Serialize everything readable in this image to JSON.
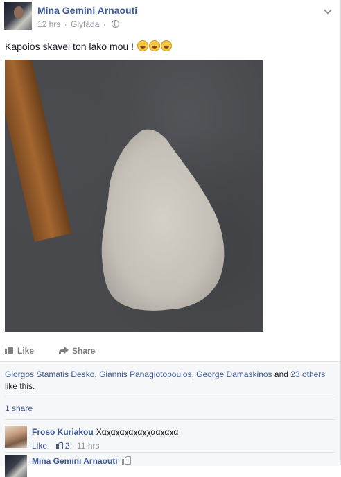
{
  "post": {
    "author": "Mina Gemini Arnaouti",
    "time": "12 hrs",
    "location": "Glyfáda",
    "separator": "·",
    "text": "Kapoios skavei ton lako mou !",
    "emoji_count": 3
  },
  "actions": {
    "like_label": "Like",
    "share_label": "Share"
  },
  "likes": {
    "names": [
      "Giorgos Stamatis Desko",
      "Giannis Panagiotopoulos",
      "George Damaskinos"
    ],
    "sep1": ", ",
    "sep2": ", ",
    "and_text": " and ",
    "others": "23 others",
    "suffix": " like this."
  },
  "shares": {
    "label": "1 share"
  },
  "comments": [
    {
      "author": "Froso Kuriakou",
      "text": "Χαχαχαχαχαχχααχαχα",
      "like_label": "Like",
      "separator": "·",
      "like_count": "2",
      "time": "11 hrs"
    },
    {
      "author": "Mina Gemini Arnaouti"
    }
  ],
  "colors": {
    "link": "#3b5998",
    "meta": "#90949c",
    "feedback_bg": "#f6f7f9"
  },
  "icons": [
    "globe-icon",
    "chevron-down-icon",
    "thumbs-up-icon",
    "share-arrow-icon",
    "laughing-emoji-icon"
  ]
}
